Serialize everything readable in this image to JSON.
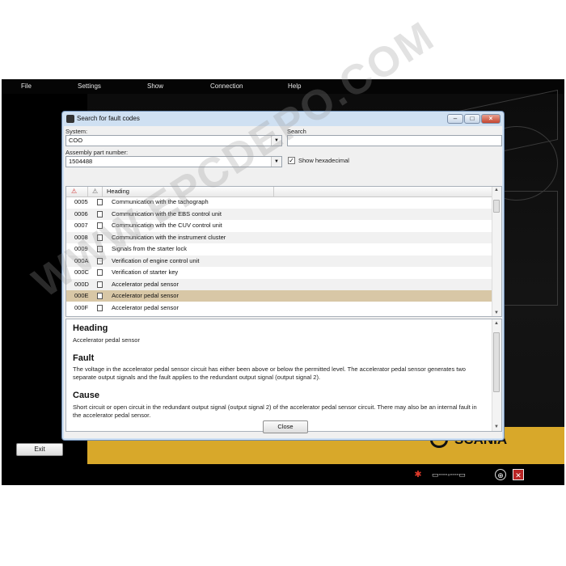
{
  "menu": [
    "File",
    "Settings",
    "Show",
    "Connection",
    "Help"
  ],
  "exit_label": "Exit",
  "brand": "SCANIA",
  "dialog": {
    "title": "Search for fault codes",
    "system_label": "System:",
    "system_value": "COO",
    "assembly_label": "Assembly part number:",
    "assembly_value": "1504488",
    "search_label": "Search",
    "search_value": "",
    "hex_label": "Show hexadecimal",
    "hex_checked": true,
    "table": {
      "heading_col": "Heading",
      "rows": [
        {
          "code": "0005",
          "text": "Communication with the tachograph"
        },
        {
          "code": "0006",
          "text": "Communication with the EBS control unit"
        },
        {
          "code": "0007",
          "text": "Communication with the CUV control unit"
        },
        {
          "code": "0008",
          "text": "Communication with the instrument cluster"
        },
        {
          "code": "0009",
          "text": "Signals from the starter lock"
        },
        {
          "code": "000A",
          "text": "Verification of engine control unit"
        },
        {
          "code": "000C",
          "text": "Verification of starter key"
        },
        {
          "code": "000D",
          "text": "Accelerator pedal sensor"
        },
        {
          "code": "000E",
          "text": "Accelerator pedal sensor",
          "selected": true
        },
        {
          "code": "000F",
          "text": "Accelerator pedal sensor"
        }
      ]
    },
    "detail": {
      "heading_title": "Heading",
      "heading_text": "Accelerator pedal sensor",
      "fault_title": "Fault",
      "fault_text": "The voltage in the accelerator pedal sensor circuit has either been above or below the permitted level. The accelerator pedal sensor generates two separate output signals and the fault applies to the redundant output signal (output signal 2).",
      "cause_title": "Cause",
      "cause_text": "Short circuit or open circuit in the redundant output signal (output signal 2) of the accelerator pedal sensor circuit. There may also be an internal fault in the accelerator pedal sensor."
    },
    "close_label": "Close"
  },
  "watermark": "WWW.EPCDEPO.COM",
  "colors": {
    "selected_row": "#d8c7a6",
    "brand_yellow": "#d8a82a",
    "title_bar": "#cfe0f2"
  },
  "status_icons": [
    "diagnostic-tool-icon",
    "computer-connection-icon",
    "network-globe-icon",
    "close-red-icon"
  ]
}
